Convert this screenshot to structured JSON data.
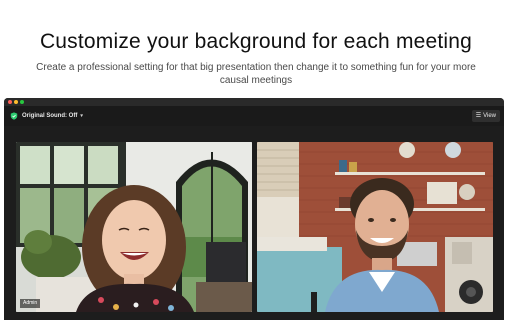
{
  "hero": {
    "title": "Customize your background for each meeting",
    "subtitle": "Create a professional setting for that big presentation then change it to something fun for your more causal meetings"
  },
  "toolbar": {
    "sound_label": "Original Sound: Off",
    "sound_caret": "▾",
    "view_icon": "☰",
    "view_label": "View"
  },
  "participants": [
    {
      "name": "Admin"
    },
    {
      "name": ""
    }
  ],
  "colors": {
    "app_background": "#1d1d1d",
    "shield_green": "#2ecc71"
  }
}
